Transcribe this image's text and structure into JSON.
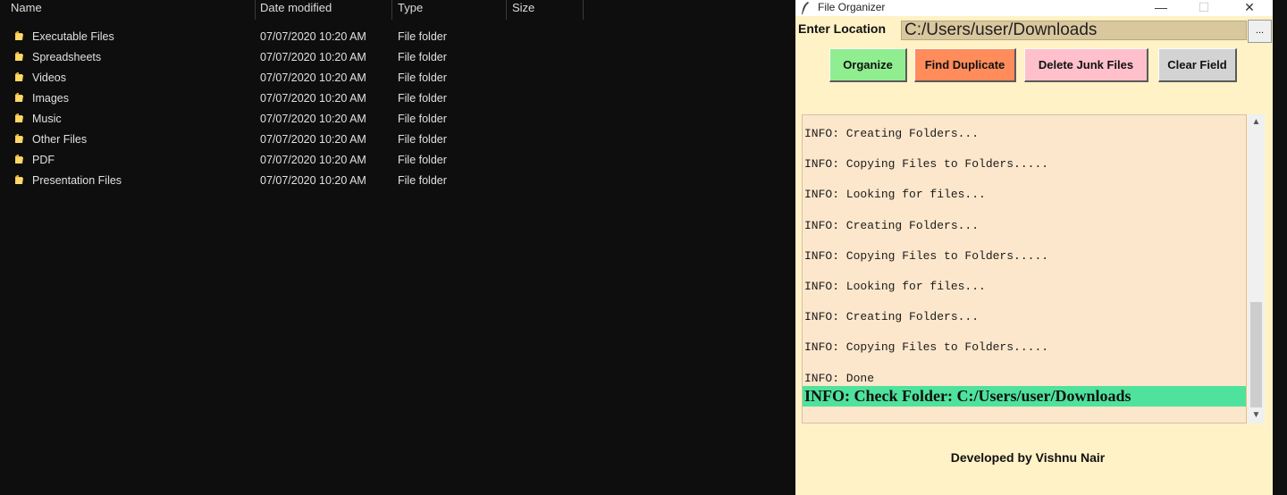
{
  "explorer": {
    "columns": {
      "name": "Name",
      "date": "Date modified",
      "type": "Type",
      "size": "Size"
    },
    "rows": [
      {
        "name": "Executable Files",
        "date": "07/07/2020 10:20 AM",
        "type": "File folder"
      },
      {
        "name": "Spreadsheets",
        "date": "07/07/2020 10:20 AM",
        "type": "File folder"
      },
      {
        "name": "Videos",
        "date": "07/07/2020 10:20 AM",
        "type": "File folder"
      },
      {
        "name": "Images",
        "date": "07/07/2020 10:20 AM",
        "type": "File folder"
      },
      {
        "name": "Music",
        "date": "07/07/2020 10:20 AM",
        "type": "File folder"
      },
      {
        "name": "Other Files",
        "date": "07/07/2020 10:20 AM",
        "type": "File folder"
      },
      {
        "name": "PDF",
        "date": "07/07/2020 10:20 AM",
        "type": "File folder"
      },
      {
        "name": "Presentation Files",
        "date": "07/07/2020 10:20 AM",
        "type": "File folder"
      }
    ]
  },
  "organizer": {
    "title": "File Organizer",
    "controls": {
      "minimize": "—",
      "maximize": "☐",
      "close": "✕"
    },
    "location_label": "Enter Location",
    "location_value": "C:/Users/user/Downloads",
    "browse_label": "...",
    "buttons": {
      "organize": "Organize",
      "find_duplicate": "Find Duplicate",
      "delete_junk": "Delete Junk Files",
      "clear_field": "Clear Field"
    },
    "log_lines": [
      "INFO: Creating Folders...",
      "INFO: Copying Files to Folders.....",
      "INFO: Looking for files...",
      "INFO: Creating Folders...",
      "INFO: Copying Files to Folders.....",
      "INFO: Looking for files...",
      "INFO: Creating Folders...",
      "INFO: Copying Files to Folders.....",
      "INFO: Done"
    ],
    "log_final": "INFO: Check Folder: C:/Users/user/Downloads",
    "footer": "Developed by Vishnu Nair",
    "colors": {
      "window_bg": "#fff2c6",
      "organize": "#90ee90",
      "find_duplicate": "#ff8c5a",
      "delete_junk": "#ffc0cb",
      "clear_field": "#d3d3d3",
      "log_bg": "#fde7cc",
      "highlight": "#4fe29c"
    }
  }
}
